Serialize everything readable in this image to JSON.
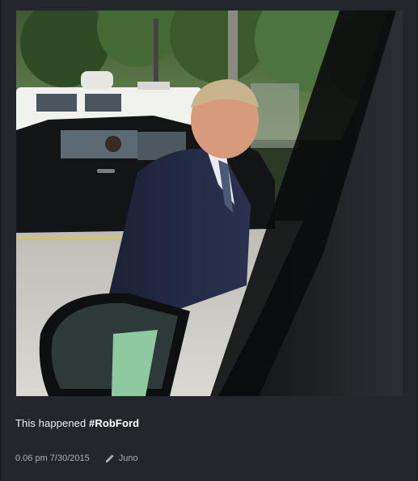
{
  "post": {
    "image_alt": "",
    "caption_text": "This happened ",
    "caption_hashtag": "#RobFord",
    "timestamp": "0.06 pm 7/30/2015",
    "author": "Juno",
    "author_icon": "pencil-icon"
  }
}
